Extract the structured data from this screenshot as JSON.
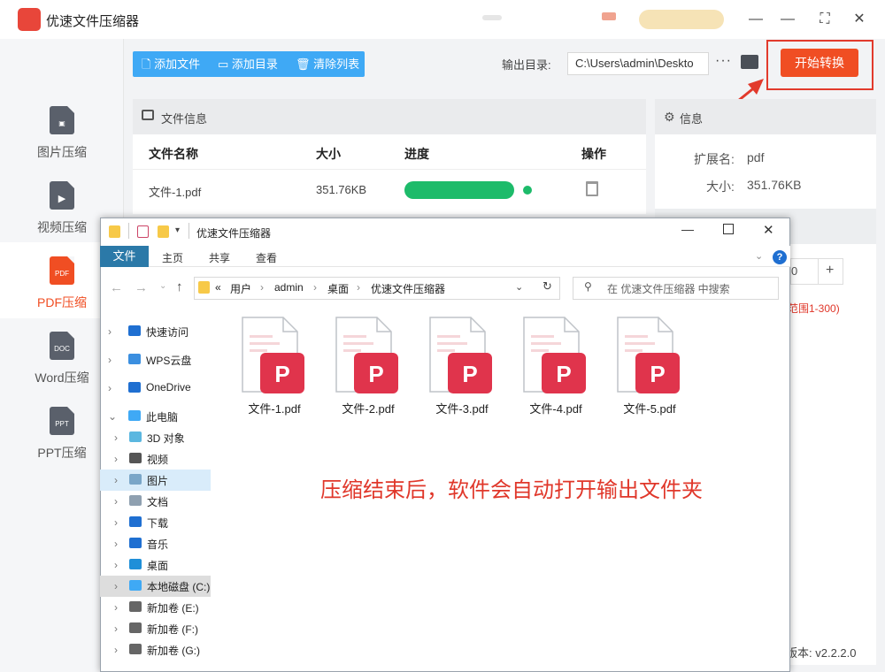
{
  "app": {
    "title": "优速文件压缩器",
    "window_controls": [
      "—",
      "☐",
      "✕"
    ],
    "brand_color": "#f04e23"
  },
  "sidebar": {
    "items": [
      {
        "label": "图片压缩",
        "icon": "image-file-icon",
        "active": false
      },
      {
        "label": "视频压缩",
        "icon": "video-file-icon",
        "active": false
      },
      {
        "label": "PDF压缩",
        "icon": "pdf-file-icon",
        "badge": "PDF",
        "active": true
      },
      {
        "label": "Word压缩",
        "icon": "word-file-icon",
        "badge": "DOC",
        "active": false
      },
      {
        "label": "PPT压缩",
        "icon": "ppt-file-icon",
        "badge": "PPT",
        "active": false
      }
    ]
  },
  "toolbar": {
    "add_file": "添加文件",
    "add_folder": "添加目录",
    "clear_list": "清除列表",
    "output_label": "输出目录:",
    "output_path": "C:\\Users\\admin\\Deskto",
    "more": "···",
    "start": "开始转换"
  },
  "file_panel": {
    "title": "文件信息",
    "columns": [
      "文件名称",
      "大小",
      "进度",
      "操作"
    ],
    "rows": [
      {
        "name": "文件-1.pdf",
        "size": "351.76KB",
        "progress": 1.0
      }
    ]
  },
  "info_panel": {
    "title": "信息",
    "ext_label": "扩展名:",
    "ext_value": "pdf",
    "size_label": "大小:",
    "size_value": "351.76KB",
    "spin_value": "0",
    "plus": "+",
    "range_hint": "范围1-300)",
    "version_label": "版本:",
    "version_value": "v2.2.2.0"
  },
  "explorer": {
    "title": "优速文件压缩器",
    "tabs": [
      "文件",
      "主页",
      "共享",
      "查看"
    ],
    "breadcrumb": [
      "«",
      "用户",
      "admin",
      "桌面",
      "优速文件压缩器"
    ],
    "search_placeholder": "在 优速文件压缩器 中搜索",
    "tree": [
      {
        "label": "快速访问",
        "icon": "star-icon",
        "color": "#1f6fd1"
      },
      {
        "label": "WPS云盘",
        "icon": "cloud-icon",
        "color": "#3b8fe0"
      },
      {
        "label": "OneDrive",
        "icon": "onedrive-icon",
        "color": "#1f6fd1"
      },
      {
        "label": "此电脑",
        "icon": "computer-icon",
        "color": "#3fa9f5",
        "expanded": true
      },
      {
        "label": "3D 对象",
        "icon": "cube-icon",
        "color": "#5bb7e0"
      },
      {
        "label": "视频",
        "icon": "film-icon",
        "color": "#555"
      },
      {
        "label": "图片",
        "icon": "picture-icon",
        "color": "#7aa6c8",
        "selected": true
      },
      {
        "label": "文档",
        "icon": "document-icon",
        "color": "#8fa0b0"
      },
      {
        "label": "下载",
        "icon": "download-icon",
        "color": "#1f6fd1"
      },
      {
        "label": "音乐",
        "icon": "music-icon",
        "color": "#1f6fd1"
      },
      {
        "label": "桌面",
        "icon": "desktop-icon",
        "color": "#1f8fd8"
      },
      {
        "label": "本地磁盘 (C:)",
        "icon": "drive-c-icon",
        "color": "#3fa9f5",
        "highlighted": true
      },
      {
        "label": "新加卷 (E:)",
        "icon": "drive-icon",
        "color": "#666"
      },
      {
        "label": "新加卷 (F:)",
        "icon": "drive-icon",
        "color": "#666"
      },
      {
        "label": "新加卷 (G:)",
        "icon": "drive-icon",
        "color": "#666"
      }
    ],
    "files": [
      "文件-1.pdf",
      "文件-2.pdf",
      "文件-3.pdf",
      "文件-4.pdf",
      "文件-5.pdf"
    ]
  },
  "caption": "压缩结束后，软件会自动打开输出文件夹"
}
